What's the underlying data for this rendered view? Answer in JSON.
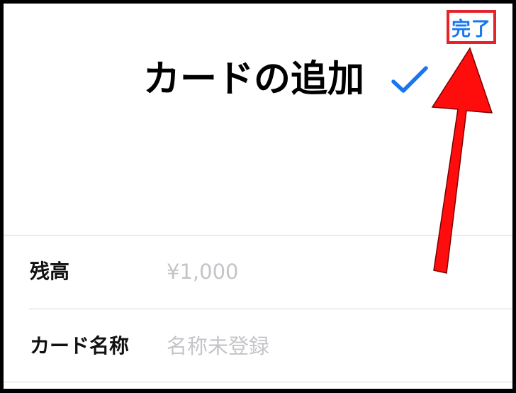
{
  "header": {
    "done_label": "完了",
    "title": "カードの追加"
  },
  "icons": {
    "title_check": "checkmark-icon",
    "annotation_arrow": "arrow-icon"
  },
  "form": {
    "balance": {
      "label": "残高",
      "value": "",
      "placeholder": "¥1,000"
    },
    "card_name": {
      "label": "カード名称",
      "value": "",
      "placeholder": "名称未登録"
    }
  },
  "colors": {
    "accent_blue": "#1876f0",
    "highlight_red": "#e4232b",
    "arrow_red": "#ff0d0d",
    "placeholder_gray": "#c4c4c9",
    "divider_gray": "#d6d6d6",
    "frame_black": "#000000"
  }
}
